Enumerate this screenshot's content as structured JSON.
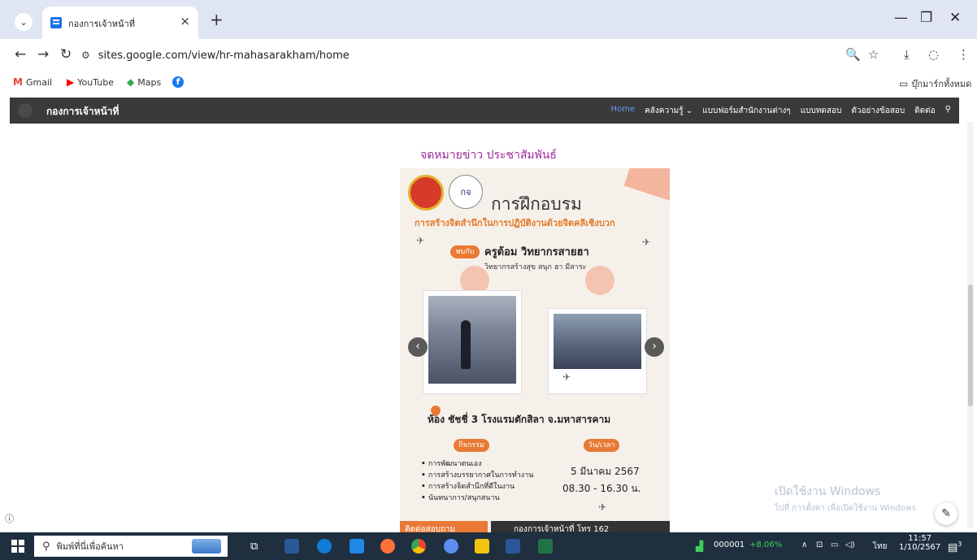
{
  "browser": {
    "tab_title": "กองการเจ้าหน้าที่",
    "tab_close": "×",
    "new_tab": "+",
    "url_text": "sites.google.com/view/hr-mahasarakham/home",
    "bookmarks": [
      {
        "label": "Gmail",
        "icon": "gmail-icon",
        "mark": "M",
        "color": "#ea4335"
      },
      {
        "label": "YouTube",
        "icon": "youtube-icon",
        "mark": "▶",
        "color": "#ff0000"
      },
      {
        "label": "Maps",
        "icon": "maps-icon",
        "mark": "◆",
        "color": "#34a853"
      },
      {
        "label": "",
        "icon": "facebook-icon",
        "mark": "f",
        "color": "#1877f2"
      }
    ],
    "bookmark_folder": "บุ๊กมาร์กทั้งหมด"
  },
  "site": {
    "title": "กองการเจ้าหน้าที่",
    "nav": [
      {
        "label": "Home",
        "active": true
      },
      {
        "label": "คลังความรู้ ⌄",
        "active": false
      },
      {
        "label": "แบบฟอร์มสำนักงานต่างๆ",
        "active": false
      },
      {
        "label": "แบบทดสอบ",
        "active": false
      },
      {
        "label": "ตัวอย่างข้อสอบ",
        "active": false
      },
      {
        "label": "ติดต่อ",
        "active": false
      }
    ],
    "heading": "จดหมายข่าว ประชาสัมพันธ์"
  },
  "poster": {
    "title": "การฝึกอบรม",
    "subtitle": "การสร้างจิตสำนึกในการปฏิบัติงานด้วยจิตคลีเชิงบวก",
    "meet_tag": "พบกับ",
    "speaker_name": "ครูต้อม วิทยากรสายฮา",
    "speaker_role": "วิทยากรสร้างสุข สนุก ฮา มีสาระ",
    "location": "ห้อง ชัชชี่ 3 โรงแรมตักสิลา จ.มหาสารคาม",
    "activity_label": "กิจกรรม",
    "datetime_label": "วัน/เวลา",
    "activities": [
      "การพัฒนาตนเอง",
      "การสร้างบรรยากาศในการทำงาน",
      "การสร้างจิตสำนึกที่ดีในงาน",
      "นันทนาการ/สนุกสนาน"
    ],
    "date": "5 มีนาคม 2567",
    "time": "08.30 - 16.30 น.",
    "footer_left": "ติดต่อสอบถาม",
    "footer_right": "กองการเจ้าหน้าที่ โทร 162",
    "emblem2_text": "กจ"
  },
  "overlay": {
    "activate_title": "เปิดใช้งาน Windows",
    "activate_sub": "ไปที่ การตั้งค่า เพื่อเปิดใช้งาน Windows"
  },
  "taskbar": {
    "search_placeholder": "พิมพ์ที่นี่เพื่อค้นหา",
    "stock_code": "000001",
    "stock_change": "+8.06%",
    "lang": "ไทย",
    "time": "11:57",
    "date": "1/10/2567",
    "notif_count": "3"
  }
}
